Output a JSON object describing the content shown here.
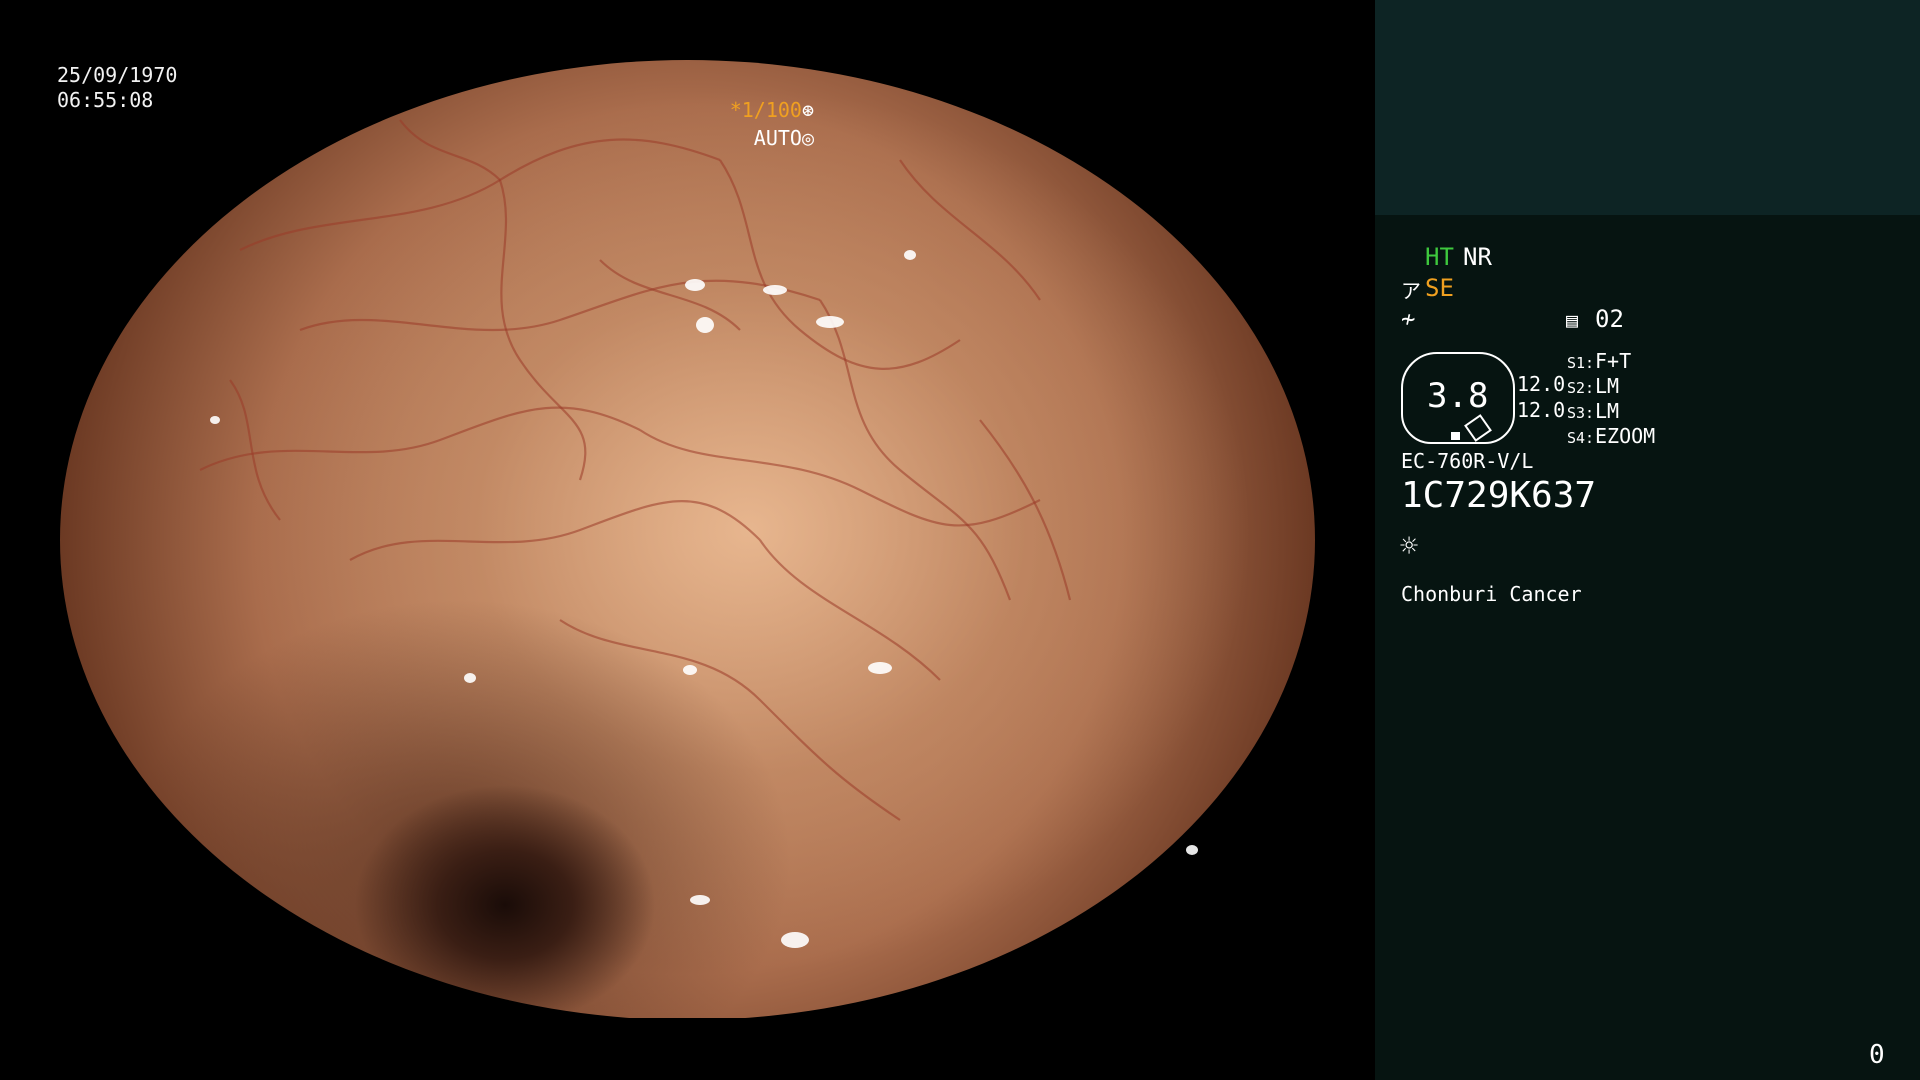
{
  "video": {
    "date": "25/09/1970",
    "time": "06:55:08",
    "shutter": "*1/100",
    "shutter_icon": "aperture-icon",
    "exposure_mode": "AUTO",
    "exposure_icon": "iris-icon"
  },
  "panel": {
    "ht": "HT",
    "nr": "NR",
    "se_icon": "ア",
    "se": "SE",
    "freeze_icon": "≁",
    "memory_icon": "▤",
    "memory": "02",
    "zoom_value": "3.8",
    "value_1": "12.0",
    "value_2": "12.0",
    "switches": [
      {
        "label": "S1:",
        "value": "F+T"
      },
      {
        "label": "S2:",
        "value": "LM"
      },
      {
        "label": "S3:",
        "value": "LM"
      },
      {
        "label": "S4:",
        "value": "EZOOM"
      }
    ],
    "scope_model": "EC-760R-V/L",
    "scope_serial": "1C729K637",
    "light_icon": "☼",
    "institution": "Chonburi Cancer",
    "corner_number": "0"
  },
  "colors": {
    "ht_green": "#3ec83e",
    "accent_orange": "#f0a020",
    "panel_bg": "#061411",
    "panel_top_bg": "#0d2424"
  }
}
